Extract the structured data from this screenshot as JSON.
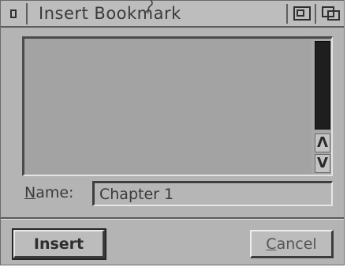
{
  "window": {
    "title": "Insert Bookmark",
    "system_icon": "system-menu-icon",
    "title_buttons": [
      "minimize-icon",
      "restore-icon"
    ]
  },
  "bookmark_list": {
    "items": [],
    "scroll_up_label": "Λ",
    "scroll_down_label": "V"
  },
  "name_field": {
    "label_first": "N",
    "label_rest": "ame:",
    "value": "Chapter 1"
  },
  "buttons": {
    "insert_label": "Insert",
    "cancel_first": "C",
    "cancel_rest": "ancel"
  },
  "colors": {
    "window_bg": "#b4b4b4",
    "list_bg": "#a3a3a3",
    "scroll_thumb": "#1e1e1e"
  }
}
